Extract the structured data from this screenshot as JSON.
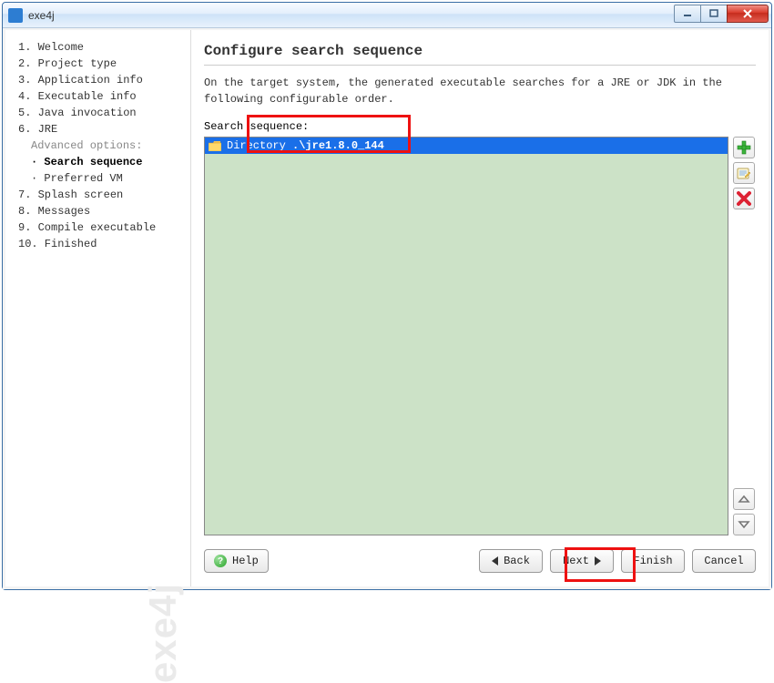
{
  "window": {
    "title": "exe4j"
  },
  "nav": {
    "items": [
      "1. Welcome",
      "2. Project type",
      "3. Application info",
      "4. Executable info",
      "5. Java invocation",
      "6. JRE"
    ],
    "advanced_label": "Advanced options:",
    "sub": [
      "Search sequence",
      "Preferred VM"
    ],
    "active_sub_index": 0,
    "items2": [
      "7. Splash screen",
      "8. Messages",
      "9. Compile executable",
      "10. Finished"
    ]
  },
  "watermark": "exe4j",
  "main": {
    "title": "Configure search sequence",
    "desc": "On the target system, the generated executable searches for a JRE or JDK in the following configurable order.",
    "seq_label": "Search sequence:",
    "entry_prefix": "Directory ",
    "entry_path": ".\\jre1.8.0_144"
  },
  "footer": {
    "help": "Help",
    "back": "Back",
    "next": "Next",
    "finish": "Finish",
    "cancel": "Cancel"
  }
}
